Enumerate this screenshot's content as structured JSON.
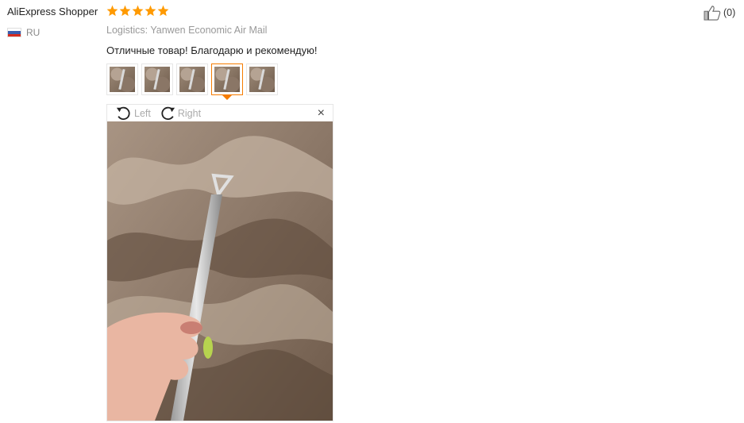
{
  "review": {
    "author": "AliExpress Shopper",
    "country_code": "RU",
    "rating": 5,
    "logistics": "Logistics: Yanwen Economic Air Mail",
    "text": "Отличные товар! Благодарю и рекомендую!",
    "like_count": "(0)"
  },
  "viewer": {
    "rotate_left_label": "Left",
    "rotate_right_label": "Right",
    "close_label": "×"
  },
  "colors": {
    "star": "#ff9a00",
    "active_thumb": "#f57c00"
  },
  "icons": [
    "star-icon",
    "thumbs-up-icon",
    "rotate-left-icon",
    "rotate-right-icon",
    "close-icon",
    "russia-flag-icon"
  ],
  "thumbnails": {
    "count": 5,
    "active_index": 3
  }
}
